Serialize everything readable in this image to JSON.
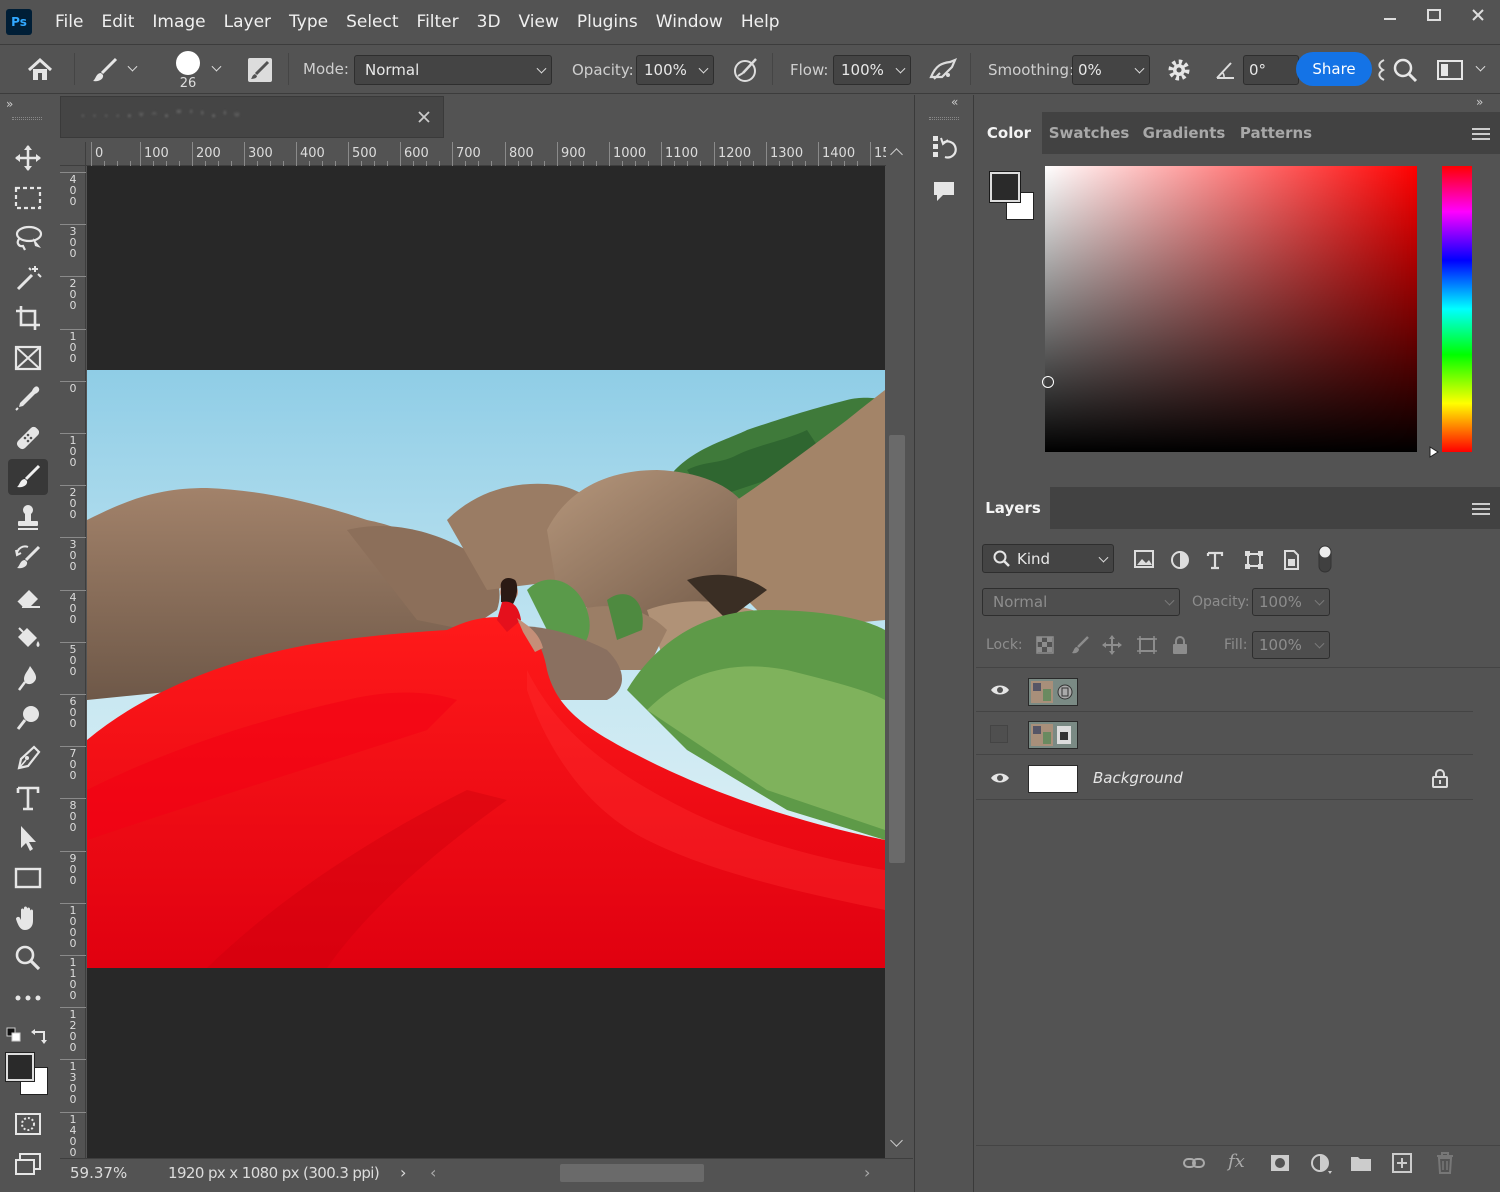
{
  "menu": [
    "File",
    "Edit",
    "Image",
    "Layer",
    "Type",
    "Select",
    "Filter",
    "3D",
    "View",
    "Plugins",
    "Window",
    "Help"
  ],
  "app_logo": "Ps",
  "options": {
    "brush_size": "26",
    "mode_label": "Mode:",
    "mode_value": "Normal",
    "opacity_label": "Opacity:",
    "opacity_value": "100%",
    "flow_label": "Flow:",
    "flow_value": "100%",
    "smoothing_label": "Smoothing:",
    "smoothing_value": "0%",
    "angle_value": "0°",
    "share_label": "Share"
  },
  "document": {
    "tab_title": "· · ·  · ꞏ ᵛ ᵔ  ꞏ ʺ ʹ  ꞌ ꞏ ꞌ ᵘ",
    "zoom": "59.37%",
    "info": "1920 px x 1080 px (300.3 ppi)",
    "h_ruler": [
      "0",
      "100",
      "200",
      "300",
      "400",
      "500",
      "600",
      "700",
      "800",
      "900",
      "1000",
      "1100",
      "1200",
      "1300",
      "1400",
      "15"
    ],
    "v_ruler": [
      "400",
      "300",
      "200",
      "100",
      "0",
      "100",
      "200",
      "300",
      "400",
      "500",
      "600",
      "700",
      "800",
      "900",
      "1000",
      "1100",
      "1200",
      "1300",
      "1400"
    ]
  },
  "color_panel": {
    "tabs": [
      "Color",
      "Swatches",
      "Gradients",
      "Patterns"
    ],
    "active_tab": "Color",
    "foreground": "#2a2a2a",
    "background": "#ffffff"
  },
  "layers_panel": {
    "tab": "Layers",
    "filter_kind": "Kind",
    "blend_mode": "Normal",
    "opacity_label": "Opacity:",
    "opacity_value": "100%",
    "lock_label": "Lock:",
    "fill_label": "Fill:",
    "fill_value": "100%",
    "layers": [
      {
        "name": "",
        "visible": true
      },
      {
        "name": "",
        "visible": false
      },
      {
        "name": "Background",
        "visible": true,
        "locked": true
      }
    ]
  },
  "icons": [
    "home-icon",
    "brush-icon",
    "brush-settings-icon",
    "airbrush-icon",
    "pressure-icon",
    "gear-icon",
    "angle-icon",
    "search-icon",
    "workspace-icon",
    "move-tool-icon",
    "marquee-tool-icon",
    "lasso-tool-icon",
    "magic-wand-icon",
    "crop-tool-icon",
    "frame-tool-icon",
    "eyedropper-icon",
    "healing-brush-icon",
    "brush-tool-icon",
    "clone-stamp-icon",
    "history-brush-icon",
    "eraser-icon",
    "paint-bucket-icon",
    "blur-tool-icon",
    "dodge-tool-icon",
    "pen-tool-icon",
    "type-tool-icon",
    "path-select-icon",
    "rectangle-tool-icon",
    "hand-tool-icon",
    "zoom-tool-icon",
    "more-tools-icon",
    "quick-mask-icon",
    "screen-mode-icon",
    "history-panel-icon",
    "comments-icon"
  ]
}
